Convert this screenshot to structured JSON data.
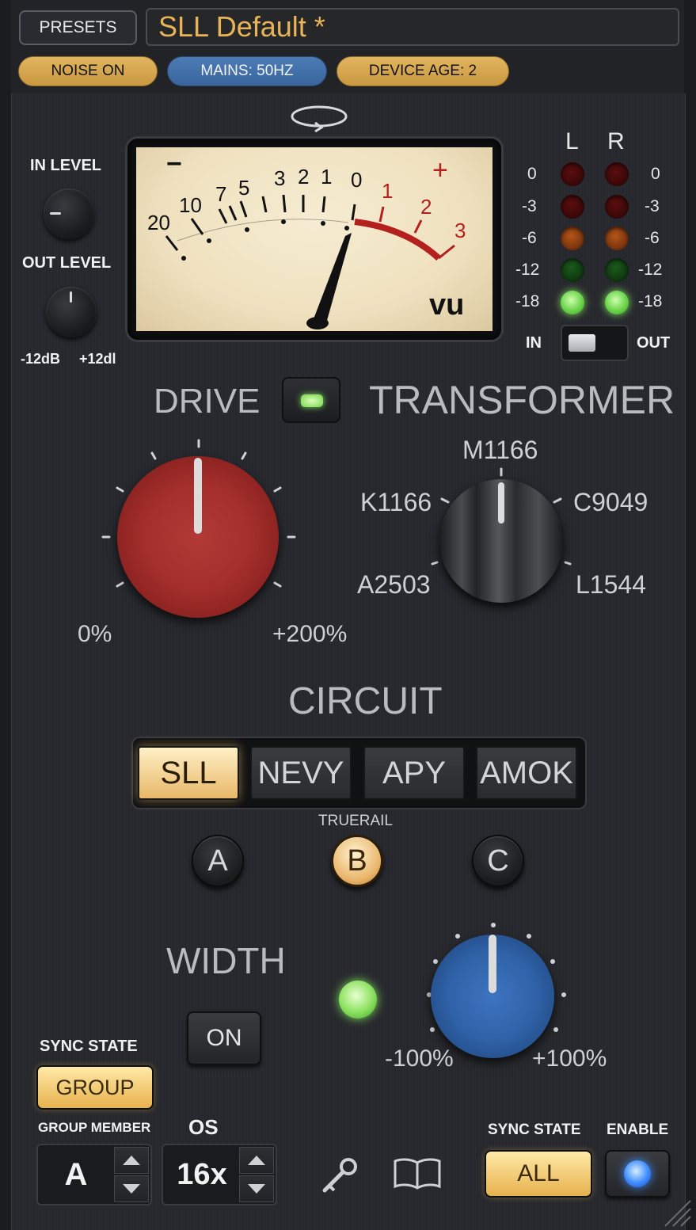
{
  "header": {
    "presets_label": "PRESETS",
    "preset_name": "SLL Default *",
    "noise_label": "NOISE ON",
    "mains_label": "MAINS: 50HZ",
    "device_age_label": "DEVICE AGE: 2"
  },
  "levels": {
    "in_label": "IN LEVEL",
    "out_label": "OUT LEVEL",
    "min_label": "-12dB",
    "max_label": "+12dl"
  },
  "vu_meter": {
    "scale_labels": [
      "20",
      "10",
      "7",
      "5",
      "3",
      "2",
      "1",
      "0",
      "1",
      "2",
      "3"
    ],
    "minus_label": "−",
    "plus_label": "+",
    "unit_label": "vu"
  },
  "meters": {
    "left_label": "L",
    "right_label": "R",
    "scale": [
      "0",
      "-3",
      "-6",
      "-12",
      "-18"
    ],
    "in_label": "IN",
    "out_label": "OUT"
  },
  "drive": {
    "label": "DRIVE",
    "min_label": "0%",
    "max_label": "+200%"
  },
  "transformer": {
    "label": "TRANSFORMER",
    "options": {
      "top": "M1166",
      "left_top": "K1166",
      "right_top": "C9049",
      "left_bottom": "A2503",
      "right_bottom": "L1544"
    },
    "selected": "M1166"
  },
  "circuit": {
    "label": "CIRCUIT",
    "options": [
      "SLL",
      "NEVY",
      "APY",
      "AMOK"
    ],
    "selected": "SLL",
    "truerail_label": "TRUERAIL",
    "variants": [
      "A",
      "B",
      "C"
    ],
    "selected_variant": "B"
  },
  "width": {
    "label": "WIDTH",
    "on_label": "ON",
    "min_label": "-100%",
    "max_label": "+100%"
  },
  "footer": {
    "sync_state_label": "SYNC STATE",
    "group_label": "GROUP",
    "group_member_label": "GROUP MEMBER",
    "group_member_value": "A",
    "os_label": "OS",
    "os_value": "16x",
    "sync_state_right_label": "SYNC STATE",
    "all_label": "ALL",
    "enable_label": "ENABLE"
  },
  "icons": {
    "reset": "cycle-arrow-icon",
    "key": "key-icon",
    "manual": "book-icon",
    "resize": "resize-grip-icon"
  },
  "colors": {
    "accent_gold": "#e9b458",
    "mains_blue": "#4c7bb5",
    "drive_red": "#a8302e",
    "width_blue": "#2f62a8",
    "led_green": "#7de05a"
  }
}
